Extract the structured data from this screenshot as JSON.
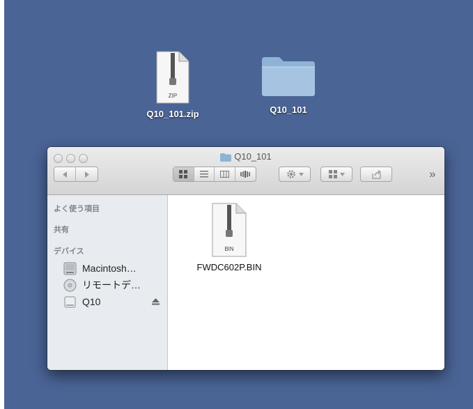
{
  "desktop": {
    "items": [
      {
        "label": "Q10_101.zip",
        "icon": "zip-file-icon"
      },
      {
        "label": "Q10_101",
        "icon": "folder-icon"
      }
    ]
  },
  "window": {
    "title": "Q10_101",
    "toolbar": {
      "overflow": "»"
    },
    "sidebar": {
      "sections": [
        "よく使う項目",
        "共有",
        "デバイス"
      ],
      "devices": [
        {
          "label": "Macintosh…",
          "icon": "hard-drive-icon"
        },
        {
          "label": "リモートデ…",
          "icon": "remote-disc-icon"
        },
        {
          "label": "Q10",
          "icon": "external-drive-icon"
        }
      ]
    },
    "files": [
      {
        "name": "FWDC602P.BIN",
        "badge": "BIN",
        "icon": "bin-file-icon"
      }
    ]
  },
  "icon_badges": {
    "zip": "ZIP"
  },
  "colors": {
    "desktop": "#4a6496",
    "sidebar": "#e8ebef"
  }
}
